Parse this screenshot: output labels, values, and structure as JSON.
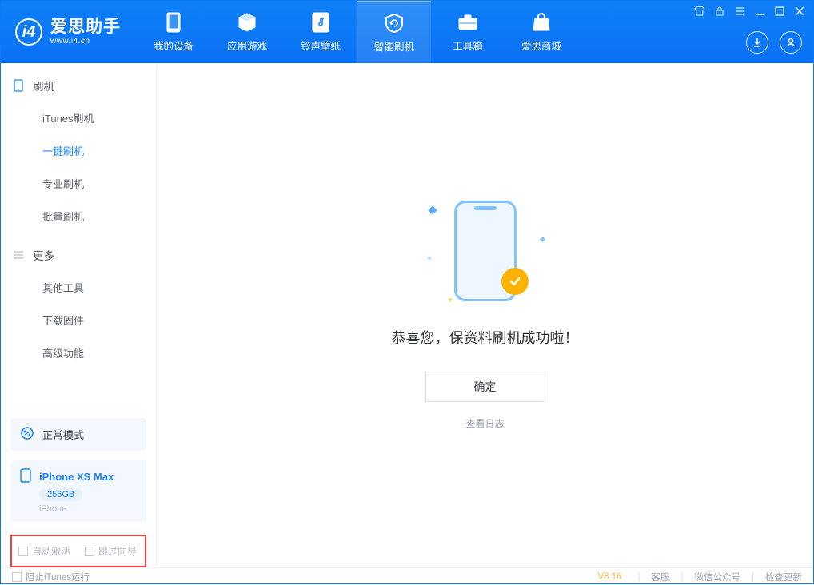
{
  "brand": {
    "title": "爱思助手",
    "url": "www.i4.cn"
  },
  "tabs": [
    {
      "label": "我的设备"
    },
    {
      "label": "应用游戏"
    },
    {
      "label": "铃声壁纸"
    },
    {
      "label": "智能刷机"
    },
    {
      "label": "工具箱"
    },
    {
      "label": "爱思商城"
    }
  ],
  "sidebar": {
    "section1": {
      "title": "刷机"
    },
    "items1": [
      {
        "label": "iTunes刷机"
      },
      {
        "label": "一键刷机"
      },
      {
        "label": "专业刷机"
      },
      {
        "label": "批量刷机"
      }
    ],
    "section2": {
      "title": "更多"
    },
    "items2": [
      {
        "label": "其他工具"
      },
      {
        "label": "下载固件"
      },
      {
        "label": "高级功能"
      }
    ]
  },
  "mode": {
    "label": "正常模式"
  },
  "device": {
    "name": "iPhone XS Max",
    "capacity": "256GB",
    "type": "iPhone"
  },
  "checkbox": {
    "auto_activate": "自动激活",
    "skip_guide": "跳过向导"
  },
  "main": {
    "success": "恭喜您，保资料刷机成功啦！",
    "ok": "确定",
    "view_log": "查看日志"
  },
  "statusbar": {
    "block_itunes": "阻止iTunes运行",
    "version": "V8.16",
    "service": "客服",
    "wechat": "微信公众号",
    "update": "检查更新"
  }
}
